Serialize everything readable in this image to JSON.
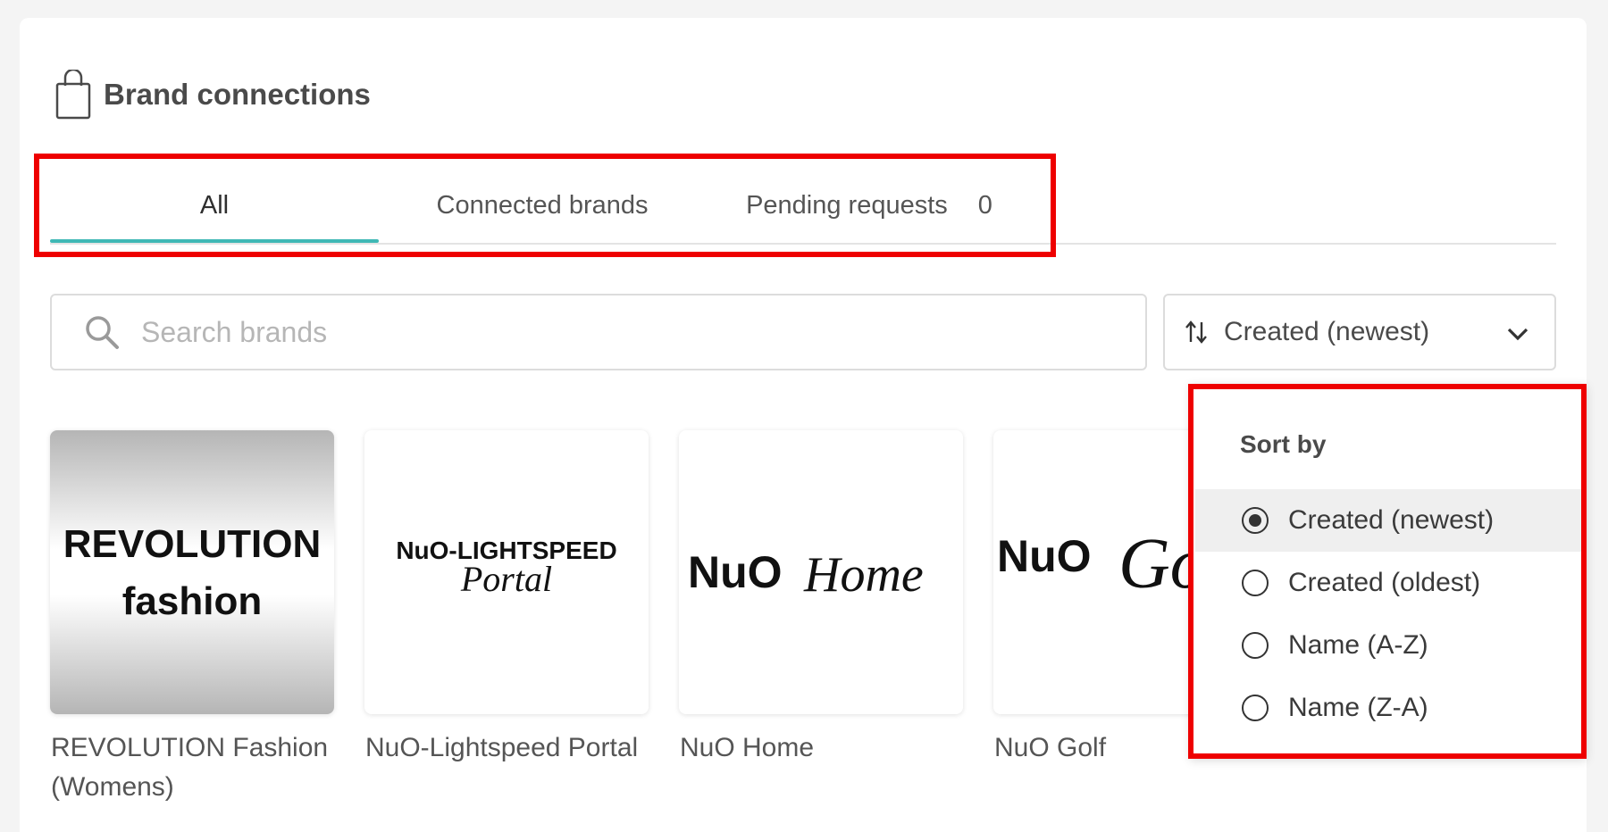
{
  "header": {
    "title": "Brand connections",
    "icon": "shopping-bag-icon"
  },
  "tabs": [
    {
      "label": "All",
      "active": true
    },
    {
      "label": "Connected brands",
      "active": false
    },
    {
      "label": "Pending requests",
      "count": "0",
      "active": false
    }
  ],
  "search": {
    "placeholder": "Search brands",
    "value": "",
    "icon": "search-icon"
  },
  "sort": {
    "selected": "Created (newest)",
    "icon": "sort-arrows-icon",
    "chevron": "chevron-down-icon"
  },
  "brands": [
    {
      "name": "REVOLUTION Fashion (Womens)",
      "logo_line1": "REVOLUTION",
      "logo_line2": "fashion"
    },
    {
      "name": "NuO-Lightspeed Portal",
      "logo_line1": "NuO-LIGHTSPEED",
      "logo_line2": "Portal"
    },
    {
      "name": "NuO Home",
      "logo_line1": "NuO",
      "logo_line2": "Home"
    },
    {
      "name": "NuO Golf",
      "logo_line1": "NuO",
      "logo_line2": "Golf"
    }
  ],
  "sort_menu": {
    "heading": "Sort by",
    "options": [
      {
        "label": "Created (newest)",
        "checked": true
      },
      {
        "label": "Created (oldest)",
        "checked": false
      },
      {
        "label": "Name (A-Z)",
        "checked": false
      },
      {
        "label": "Name (Z-A)",
        "checked": false
      }
    ]
  },
  "colors": {
    "accent": "#3fb8b5",
    "highlight": "#ee0000"
  }
}
